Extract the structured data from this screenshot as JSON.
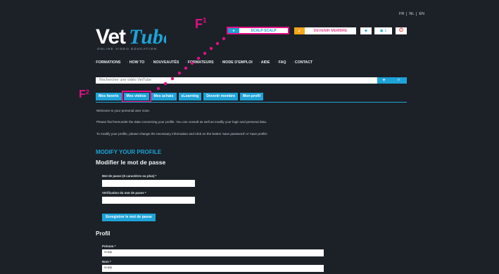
{
  "lang": [
    "FR",
    "NL",
    "EN"
  ],
  "logo": {
    "text": "VetTube",
    "tagline": "ONLINE VIDEO EDUCATION"
  },
  "user_button": {
    "icon": "user-icon",
    "label": "SCALP SCALP"
  },
  "member_button": {
    "icon": "check-icon",
    "label": "DEVENIR MEMBRE"
  },
  "heart_icon": "♥",
  "cart": {
    "icon": "cart-icon",
    "count": "1"
  },
  "power_icon": "⏻",
  "nav": [
    "FORMATIONS",
    "HOW TO",
    "NOUVEAUTÉS",
    "FORMATEURS",
    "MODE D'EMPLOI",
    "AIDE",
    "FAQ",
    "CONTACT"
  ],
  "search": {
    "placeholder": "Rechercher une vidéo VetTube",
    "plus": "+",
    "mag": "⌕"
  },
  "tabs": [
    "Mes favoris",
    "Mes vidéos",
    "Mes achats",
    "eLearning",
    "Devenir membre",
    "Mon profil"
  ],
  "intro": [
    "Welcome to your personal user zone.",
    "Please find hereunder the data concerning your profile. You can consult as well as modify your login and personal data.",
    "To modify your profile, please change the necessary information and click on the button 'save password' or 'save profile'."
  ],
  "modify_title": "MODIFY YOUR PROFILE",
  "password_title": "Modifier le mot de passe",
  "password_label": "Mot de passe (6 caractères ou plus) *",
  "verify_label": "Vérification du mot de passe *",
  "save_password": "Enregistrer le mot de passe",
  "profil_title": "Profil",
  "prenom_label": "Prénom *",
  "prenom_value": "scalp",
  "nom_label": "Nom *",
  "nom_value": "scalp",
  "annotations": {
    "f1": "F",
    "f1_sup": "1",
    "f2": "F",
    "f2_sup": "2"
  },
  "colors": {
    "accent": "#1ea3d8",
    "highlight": "#e20f86",
    "orange": "#f7a618",
    "background": "#1b2127"
  }
}
